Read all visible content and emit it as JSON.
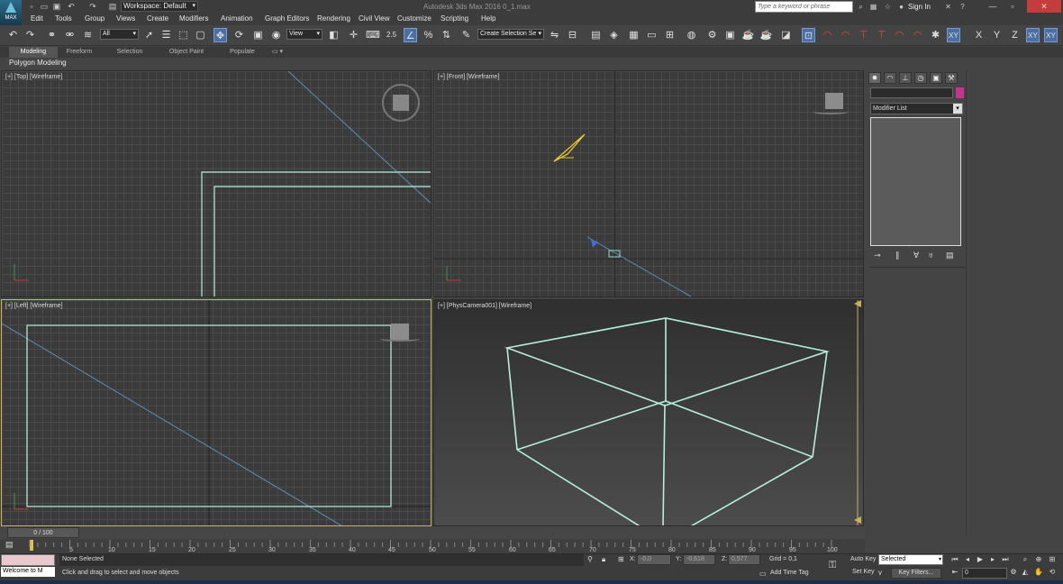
{
  "app": {
    "logo_text": "MAX",
    "title": "Autodesk 3ds Max 2016    0_1.max",
    "workspace": "Workspace: Default",
    "search_placeholder": "Type a keyword or phrase",
    "sign_in": "Sign In"
  },
  "menu": [
    "Edit",
    "Tools",
    "Group",
    "Views",
    "Create",
    "Modifiers",
    "Animation",
    "Graph Editors",
    "Rendering",
    "Civil View",
    "Customize",
    "Scripting",
    "Help"
  ],
  "toolbar": {
    "selection_filter": "All",
    "ref_coord": "View",
    "snap_value": "2.5",
    "named_selection": "Create Selection Se",
    "axis_x": "X",
    "axis_y": "Y",
    "axis_z": "Z",
    "axis_xy": "XY",
    "axis_xy2": "XY"
  },
  "ribbon": {
    "tabs": [
      "Modeling",
      "Freeform",
      "Selection",
      "Object Paint",
      "Populate"
    ],
    "active_tab": "Modeling",
    "sub_label": "Polygon Modeling"
  },
  "viewports": {
    "top": {
      "label": "[+] [Top] [Wireframe]"
    },
    "front": {
      "label": "[+] [Front] [Wireframe]"
    },
    "left": {
      "label": "[+] [Left] [Wireframe]"
    },
    "persp": {
      "label": "[+] [PhysCamera001] [Wireframe]"
    }
  },
  "command_panel": {
    "modifier_list": "Modifier List",
    "accent_color": "#c6358d"
  },
  "timeline": {
    "current": "0 / 100",
    "ticks": [
      "5",
      "10",
      "15",
      "20",
      "25",
      "30",
      "35",
      "40",
      "45",
      "50",
      "55",
      "60",
      "65",
      "70",
      "75",
      "80",
      "85",
      "90",
      "95",
      "100"
    ]
  },
  "status": {
    "selection": "None Selected",
    "prompt": "Click and drag to select and move objects",
    "listener": "Welcome to M",
    "x_label": "X:",
    "x_value": "-0,0",
    "y_label": "Y:",
    "y_value": "-0,618",
    "z_label": "Z:",
    "z_value": "0,577",
    "grid": "Grid = 0,1",
    "add_time_tag": "Add Time Tag",
    "auto_key": "Auto Key",
    "set_key": "Set Key",
    "key_mode": "Selected",
    "key_filters": "Key Filters...",
    "frame": "0"
  },
  "colors": {
    "wire_green": "#b6efd9",
    "line_blue": "#5a8fb4",
    "active_border": "#c9b15a"
  }
}
